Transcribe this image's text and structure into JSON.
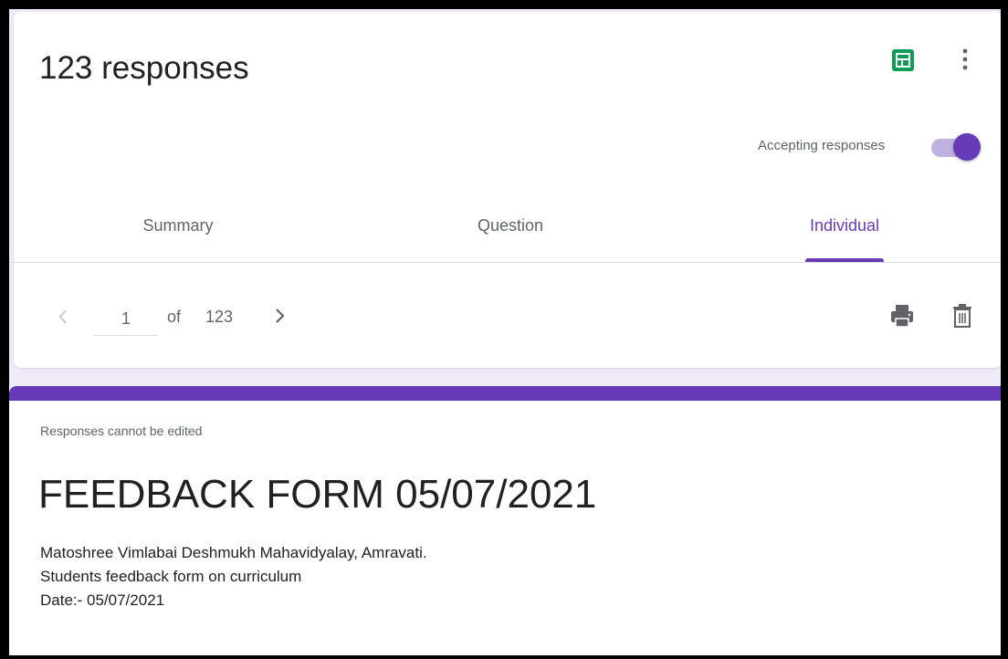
{
  "header": {
    "responses_title": "123 responses",
    "accepting_label": "Accepting responses",
    "accepting_on": true
  },
  "tabs": [
    {
      "label": "Summary",
      "active": false
    },
    {
      "label": "Question",
      "active": false
    },
    {
      "label": "Individual",
      "active": true
    }
  ],
  "pager": {
    "current": "1",
    "of_label": "of",
    "total": "123"
  },
  "icons": {
    "sheets": "google-sheets-icon",
    "more": "more-vert-icon",
    "prev": "chevron-left-icon",
    "next": "chevron-right-icon",
    "print": "print-icon",
    "delete": "trash-icon"
  },
  "response": {
    "notice": "Responses cannot be edited",
    "form_title": "FEEDBACK FORM 05/07/2021",
    "description_lines": [
      "Matoshree Vimlabai Deshmukh Mahavidyalay, Amravati.",
      "Students feedback form on curriculum",
      "Date:- 05/07/2021"
    ]
  },
  "colors": {
    "accent": "#673ab7",
    "toggle_track": "#bfb2e0",
    "sheets_green": "#0f9d58",
    "background": "#f0ebf8"
  }
}
